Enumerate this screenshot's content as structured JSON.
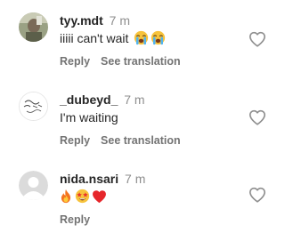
{
  "comments": [
    {
      "username": "tyy.mdt",
      "time": "7 m",
      "text": "iiiii can't wait",
      "text_emojis": [
        "loudly-crying-face",
        "loudly-crying-face"
      ],
      "reply_label": "Reply",
      "translate_label": "See translation",
      "avatar": "profile-photo"
    },
    {
      "username": "_dubeyd_",
      "time": "7 m",
      "text": "I'm waiting",
      "text_emojis": [],
      "reply_label": "Reply",
      "translate_label": "See translation",
      "avatar": "sketch-logo"
    },
    {
      "username": "nida.nsari",
      "time": "7 m",
      "text": "",
      "text_emojis": [
        "fire",
        "star-struck-face",
        "red-heart"
      ],
      "reply_label": "Reply",
      "translate_label": "",
      "avatar": "default-avatar"
    }
  ],
  "colors": {
    "username": "#262626",
    "meta": "#8e8e8e",
    "action": "#737373",
    "heart_outline": "#8e8e8e"
  },
  "icons": {
    "like": "heart-outline-icon"
  }
}
